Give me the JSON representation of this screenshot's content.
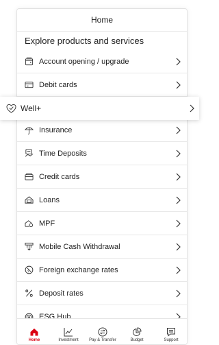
{
  "header": {
    "title": "Home"
  },
  "section": {
    "title": "Explore products and services"
  },
  "items": [
    {
      "label": "Account opening / upgrade",
      "icon": "wallet-icon"
    },
    {
      "label": "Debit cards",
      "icon": "card-icon"
    },
    {
      "label": "Well+",
      "icon": "heart-check-icon"
    },
    {
      "label": "Insurance",
      "icon": "umbrella-icon"
    },
    {
      "label": "Time Deposits",
      "icon": "time-deposit-icon"
    },
    {
      "label": "Credit cards",
      "icon": "credit-card-icon"
    },
    {
      "label": "Loans",
      "icon": "loan-icon"
    },
    {
      "label": "MPF",
      "icon": "house-coin-icon"
    },
    {
      "label": "Mobile Cash Withdrawal",
      "icon": "atm-icon"
    },
    {
      "label": "Foreign exchange rates",
      "icon": "currency-exchange-icon"
    },
    {
      "label": "Deposit rates",
      "icon": "percent-icon"
    },
    {
      "label": "ESG Hub",
      "icon": "target-icon"
    }
  ],
  "tabs": [
    {
      "label": "Home",
      "icon": "home-icon",
      "active": true
    },
    {
      "label": "Investment",
      "icon": "chart-line-icon",
      "active": false
    },
    {
      "label": "Pay & Transfer",
      "icon": "transfer-icon",
      "active": false
    },
    {
      "label": "Budget",
      "icon": "budget-icon",
      "active": false
    },
    {
      "label": "Support",
      "icon": "chat-icon",
      "active": false
    }
  ],
  "colors": {
    "accent": "#db0011",
    "text": "#222222",
    "divider": "#e8e8e8"
  }
}
